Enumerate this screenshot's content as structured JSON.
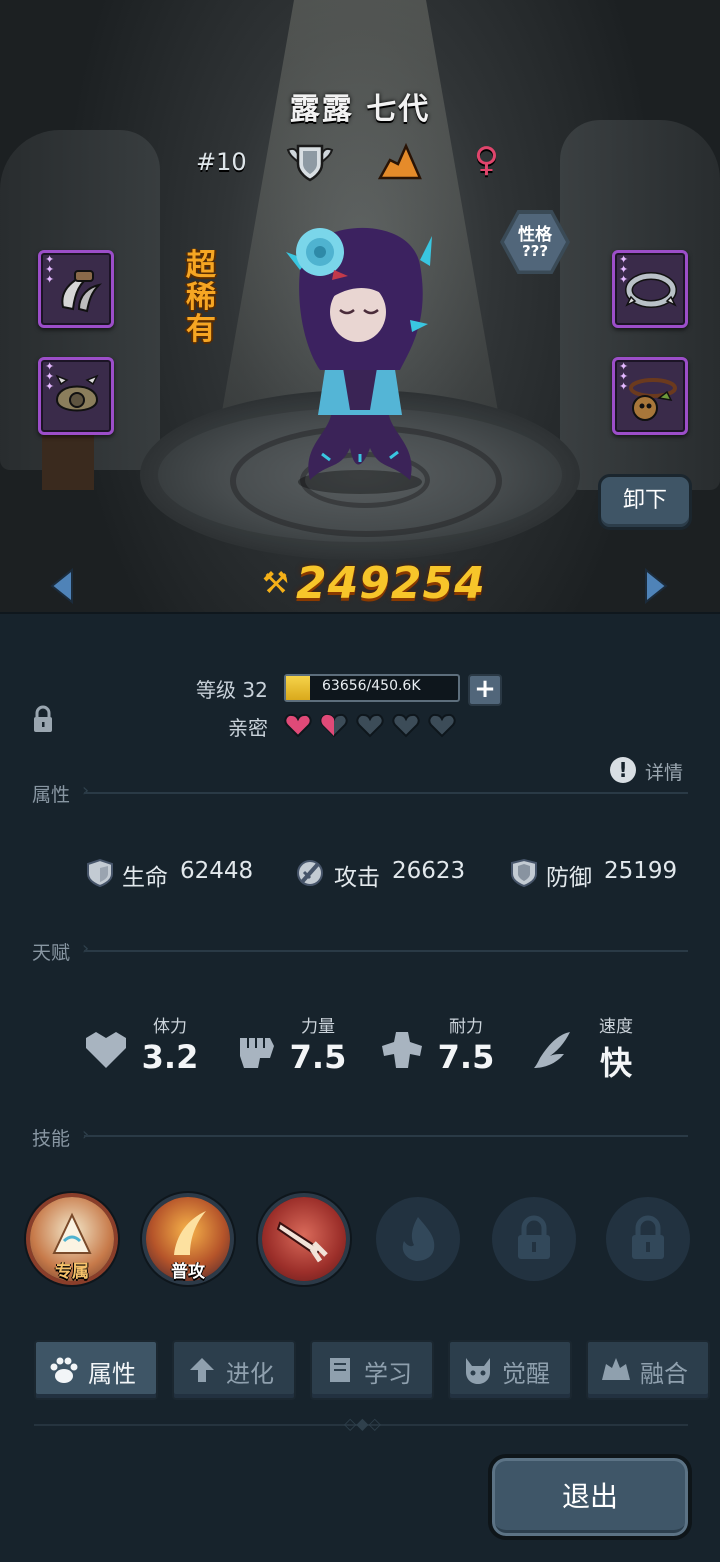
{
  "monster": {
    "name": "露露 七代",
    "rank": "#10",
    "rarity": "超稀有",
    "gender_icon": "female-icon",
    "personality": {
      "label": "性格",
      "value": "???"
    },
    "power": "249254",
    "unequip_label": "卸下"
  },
  "equipment_slots": [
    {
      "icon": "claw-blade-icon",
      "stars": 3
    },
    {
      "icon": "spiked-shell-icon",
      "stars": 3
    },
    {
      "icon": "spiked-collar-icon",
      "stars": 3
    },
    {
      "icon": "gourd-necklace-icon",
      "stars": 3
    }
  ],
  "level": {
    "label": "等级 32",
    "exp_text": "63656/450.6K",
    "exp_fraction": 0.141
  },
  "intimacy": {
    "label": "亲密",
    "hearts_full": 1,
    "hearts_half": 1,
    "hearts_total": 5,
    "colors": {
      "filled": "#e04a78",
      "empty": "#3c4c58"
    }
  },
  "sections": {
    "attributes": "属性",
    "talents": "天赋",
    "skills": "技能",
    "details": "详情"
  },
  "stats": [
    {
      "icon": "heart-shield-icon",
      "label": "生命",
      "value": "62448"
    },
    {
      "icon": "sword-icon",
      "label": "攻击",
      "value": "26623"
    },
    {
      "icon": "shield-icon",
      "label": "防御",
      "value": "25199"
    }
  ],
  "talents": [
    {
      "icon": "heart-icon",
      "name": "体力",
      "value": "3.2"
    },
    {
      "icon": "fist-icon",
      "name": "力量",
      "value": "7.5"
    },
    {
      "icon": "muscle-icon",
      "name": "耐力",
      "value": "7.5"
    },
    {
      "icon": "wing-icon",
      "name": "速度",
      "value": "快"
    }
  ],
  "skills": [
    {
      "icon": "exclusive-skill-icon",
      "tag": "专属"
    },
    {
      "icon": "normal-attack-icon",
      "tag": "普攻"
    },
    {
      "icon": "sword-strike-icon",
      "tag": ""
    },
    {
      "icon": "locked-flame-icon",
      "tag": ""
    },
    {
      "icon": "lock-icon",
      "tag": ""
    },
    {
      "icon": "lock-icon",
      "tag": ""
    }
  ],
  "tabs": [
    {
      "label": "属性",
      "icon": "paw-icon",
      "active": true
    },
    {
      "label": "进化",
      "icon": "evolve-arrow-icon",
      "active": false
    },
    {
      "label": "学习",
      "icon": "book-icon",
      "active": false
    },
    {
      "label": "觉醒",
      "icon": "demon-head-icon",
      "active": false
    },
    {
      "label": "融合",
      "icon": "fusion-icon",
      "active": false
    }
  ],
  "exit_label": "退出",
  "colors": {
    "accent_gold": "#f7c52a",
    "rarity_orange": "#f6a623",
    "slot_purple": "#9c4ec9",
    "panel_bg": "#17232c"
  }
}
